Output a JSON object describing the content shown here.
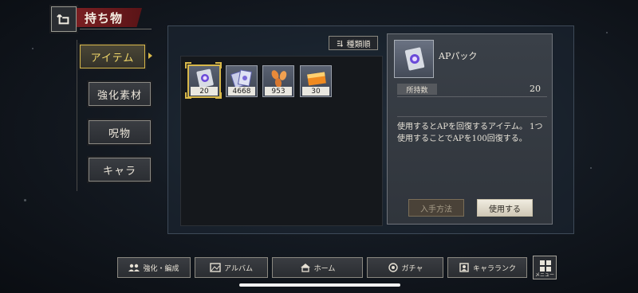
{
  "header": {
    "title": "持ち物"
  },
  "tabs": [
    {
      "label": "アイテム",
      "active": true
    },
    {
      "label": "強化素材",
      "active": false
    },
    {
      "label": "呪物",
      "active": false
    },
    {
      "label": "キャラ",
      "active": false
    }
  ],
  "sort": {
    "label": "種類順"
  },
  "items": [
    {
      "icon": "ap-pack-icon",
      "count": "20",
      "selected": true
    },
    {
      "icon": "cards-icon",
      "count": "4668",
      "selected": false
    },
    {
      "icon": "petals-icon",
      "count": "953",
      "selected": false
    },
    {
      "icon": "ticket-icon",
      "count": "30",
      "selected": false
    }
  ],
  "detail": {
    "name": "APパック",
    "owned_label": "所持数",
    "owned_value": "20",
    "description": "使用するとAPを回復するアイテム。 1つ使用することでAPを100回復する。",
    "how_to_get_label": "入手方法",
    "use_label": "使用する"
  },
  "bottom_nav": [
    {
      "label": "強化・編成",
      "icon": "party-icon"
    },
    {
      "label": "アルバム",
      "icon": "album-icon"
    },
    {
      "label": "ホーム",
      "icon": "home-icon"
    },
    {
      "label": "ガチャ",
      "icon": "gacha-icon"
    },
    {
      "label": "キャラランク",
      "icon": "rank-icon"
    }
  ],
  "menu": {
    "label": "メニュー"
  },
  "colors": {
    "accent_gold": "#d8b84a",
    "banner_red": "#7a1f22"
  }
}
